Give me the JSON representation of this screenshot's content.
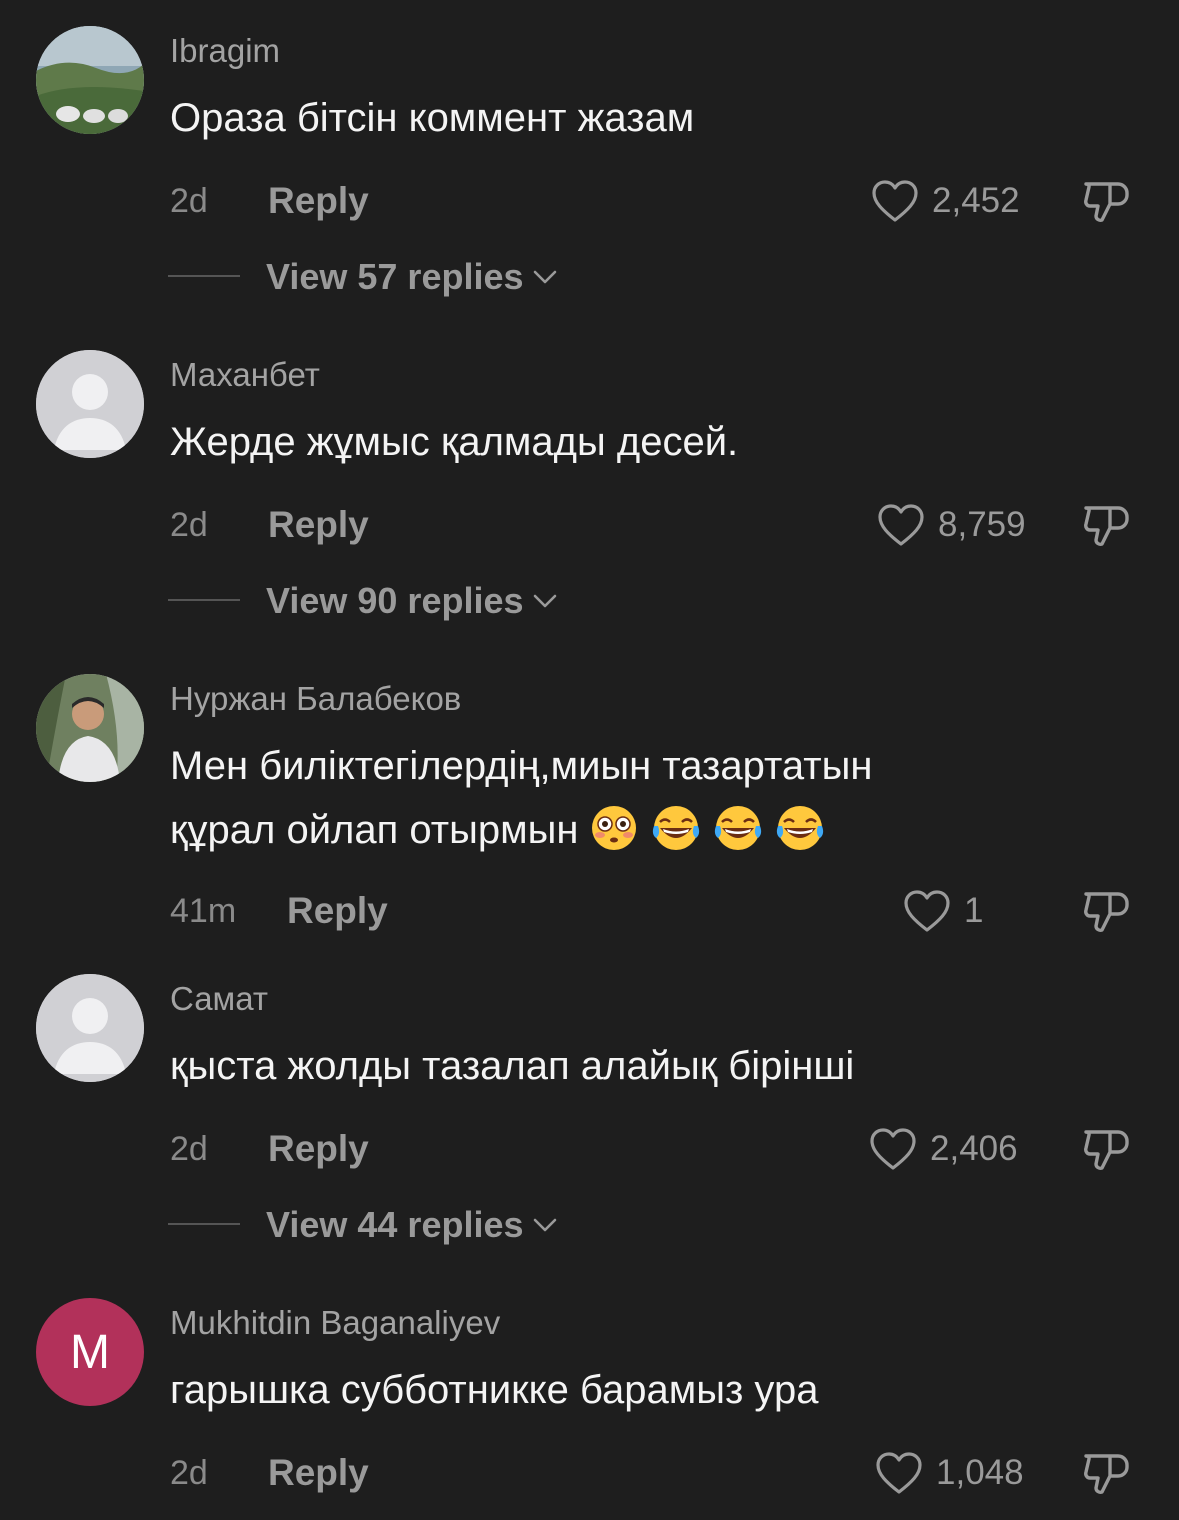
{
  "comments": [
    {
      "username": "Ibragim",
      "text": "Ораза бітсін коммент жазам",
      "time": "2d",
      "reply_label": "Reply",
      "likes": "2,452",
      "view_replies": "View 57 replies"
    },
    {
      "username": "Маханбет",
      "text": "Жерде жұмыс қалмады десей.",
      "time": "2d",
      "reply_label": "Reply",
      "likes": "8,759",
      "view_replies": "View 90 replies"
    },
    {
      "username": "Нуржан Балабеков",
      "text_line1": "Мен биліктегілердің,миын тазартатын",
      "text_line2": "құрал ойлап отырмын",
      "emojis": [
        "flushed-face",
        "tears-of-joy",
        "tears-of-joy",
        "tears-of-joy"
      ],
      "time": "41m",
      "reply_label": "Reply",
      "likes": "1"
    },
    {
      "username": "Самат",
      "text": "қыста жолды тазалап алайық бірінші",
      "time": "2d",
      "reply_label": "Reply",
      "likes": "2,406",
      "view_replies": "View 44 replies"
    },
    {
      "username": "Mukhitdin Baganaliyev",
      "avatar_letter": "M",
      "text": "гарышка субботникке барамыз ура",
      "time": "2d",
      "reply_label": "Reply",
      "likes": "1,048"
    }
  ],
  "colors": {
    "background": "#1e1e1e",
    "muted": "#9a9a9a",
    "letter_avatar": "#b2315a"
  }
}
